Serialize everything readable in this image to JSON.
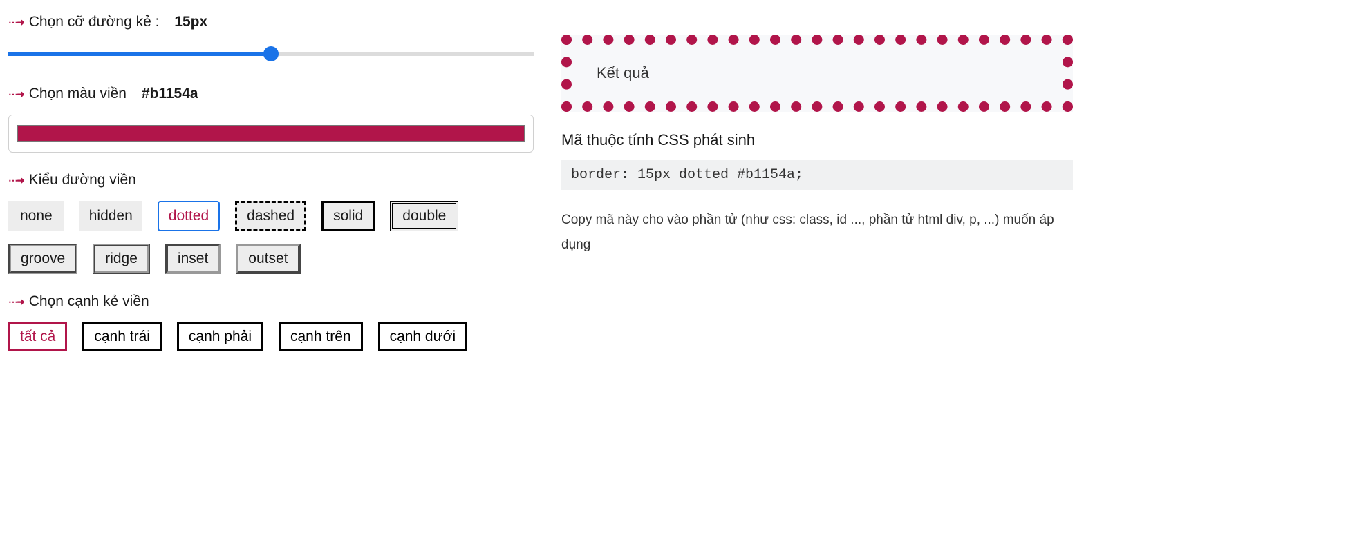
{
  "size": {
    "label": "Chọn cỡ đường kẻ :",
    "value_display": "15px",
    "value": 15,
    "min": 0,
    "max": 30
  },
  "color": {
    "label": "Chọn màu viền",
    "value": "#b1154a"
  },
  "style": {
    "label": "Kiểu đường viền",
    "options": [
      {
        "value": "none",
        "cls": "b-none"
      },
      {
        "value": "hidden",
        "cls": "b-hidden"
      },
      {
        "value": "dotted",
        "cls": "b-dotted"
      },
      {
        "value": "dashed",
        "cls": "b-dashed"
      },
      {
        "value": "solid",
        "cls": "b-solid"
      },
      {
        "value": "double",
        "cls": "b-double"
      },
      {
        "value": "groove",
        "cls": "b-groove"
      },
      {
        "value": "ridge",
        "cls": "b-ridge"
      },
      {
        "value": "inset",
        "cls": "b-inset"
      },
      {
        "value": "outset",
        "cls": "b-outset"
      }
    ],
    "selected": "dotted"
  },
  "side": {
    "label": "Chọn cạnh kẻ viền",
    "options": [
      {
        "value": "all",
        "label": "tất cả"
      },
      {
        "value": "left",
        "label": "cạnh trái"
      },
      {
        "value": "right",
        "label": "cạnh phải"
      },
      {
        "value": "top",
        "label": "cạnh trên"
      },
      {
        "value": "bottom",
        "label": "cạnh dưới"
      }
    ],
    "selected": "all"
  },
  "result": {
    "label": "Kết quả"
  },
  "generated": {
    "title": "Mã thuộc tính CSS phát sinh",
    "code": "border: 15px dotted #b1154a;",
    "hint": "Copy mã này cho vào phần tử (như css: class, id ..., phần tử html div, p, ...) muốn áp dụng"
  }
}
